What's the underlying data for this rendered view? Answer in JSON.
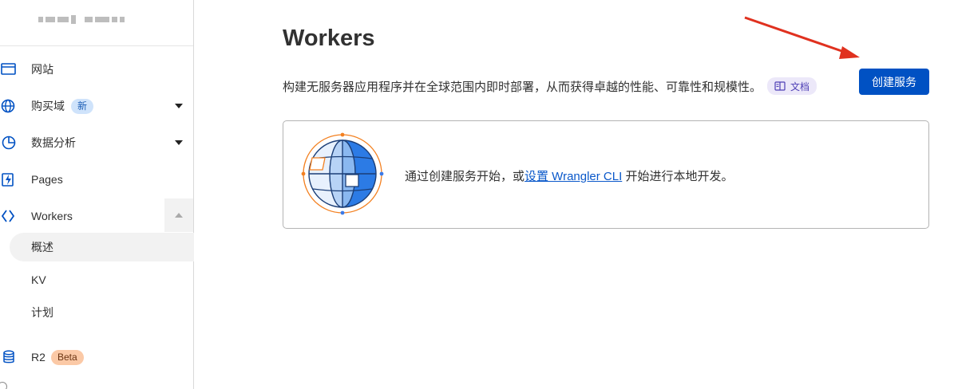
{
  "sidebar": {
    "nav": [
      {
        "label": "网站",
        "icon": "browser-window-icon"
      },
      {
        "label": "购买域",
        "icon": "globe-icon",
        "badge": "新"
      },
      {
        "label": "数据分析",
        "icon": "analytics-pie-icon"
      },
      {
        "label": "Pages",
        "icon": "pages-bolt-icon"
      },
      {
        "label": "Workers",
        "icon": "workers-logo-icon"
      },
      {
        "label": "R2",
        "icon": "database-icon",
        "badge": "Beta"
      }
    ],
    "workers_sub": [
      {
        "label": "概述",
        "active": true
      },
      {
        "label": "KV"
      },
      {
        "label": "计划"
      }
    ]
  },
  "main": {
    "title": "Workers",
    "description": "构建无服务器应用程序并在全球范围内即时部署，从而获得卓越的性能、可靠性和规模性。",
    "doc_label": "文档",
    "create_button": "创建服务",
    "card": {
      "text_before": "通过创建服务开始，或",
      "link": "设置 Wrangler CLI",
      "text_after": " 开始进行本地开发。"
    }
  },
  "colors": {
    "primary": "#0051c3",
    "annotation_arrow": "#e0311f",
    "new_badge": "#cfe3fb",
    "beta_badge": "#fbc9a6"
  }
}
